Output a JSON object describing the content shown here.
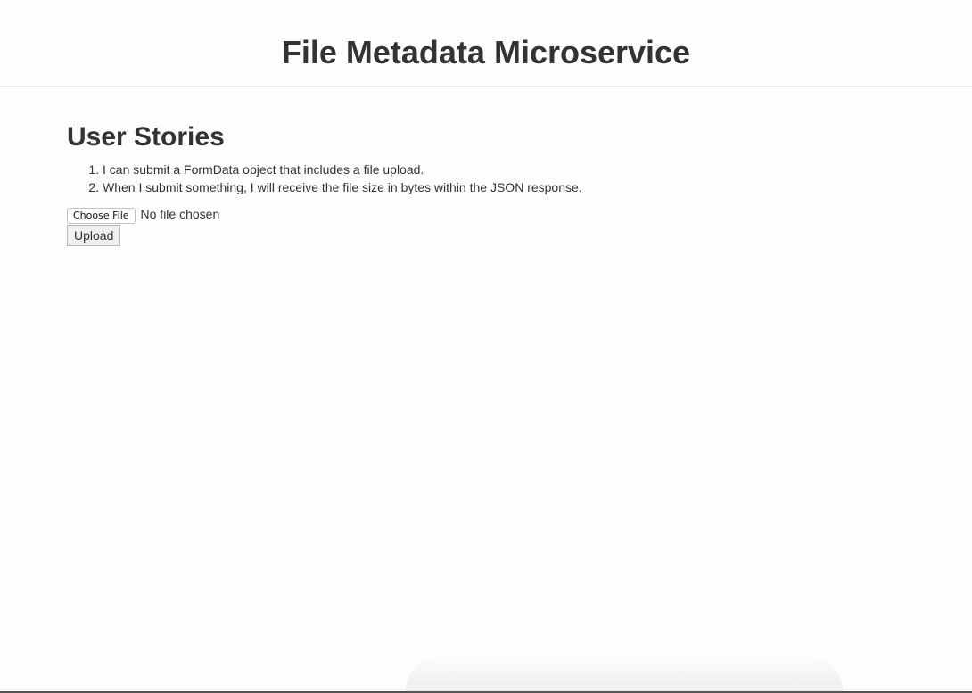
{
  "header": {
    "title": "File Metadata Microservice"
  },
  "main": {
    "heading": "User Stories",
    "stories": [
      "I can submit a FormData object that includes a file upload.",
      "When I submit something, I will receive the file size in bytes within the JSON response."
    ],
    "file_input": {
      "button_label": "Choose File",
      "status": "No file chosen"
    },
    "upload_label": "Upload"
  }
}
